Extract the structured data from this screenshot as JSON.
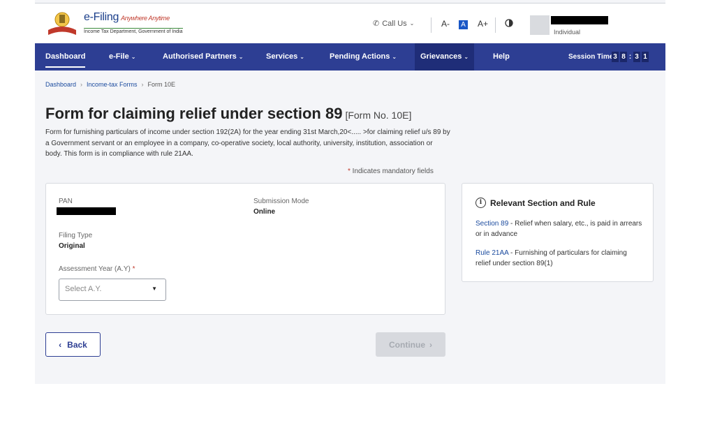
{
  "header": {
    "logo_title": "e-Filing",
    "logo_tagline": "Anywhere Anytime",
    "logo_subtitle": "Income Tax Department, Government of India",
    "call_us": "Call Us",
    "font_decrease": "A-",
    "font_normal": "A",
    "font_increase": "A+",
    "user_type": "Individual"
  },
  "nav": {
    "items": [
      {
        "label": "Dashboard"
      },
      {
        "label": "e-File"
      },
      {
        "label": "Authorised Partners"
      },
      {
        "label": "Services"
      },
      {
        "label": "Pending Actions"
      },
      {
        "label": "Grievances"
      },
      {
        "label": "Help"
      }
    ],
    "session_label": "Session Time",
    "session_digits": [
      "3",
      "8",
      "3",
      "1"
    ]
  },
  "breadcrumb": {
    "items": [
      "Dashboard",
      "Income-tax Forms",
      "Form 10E"
    ]
  },
  "page": {
    "title": "Form for claiming relief under section 89",
    "form_no": "[Form No. 10E]",
    "description": "Form for furnishing particulars of income under section 192(2A) for the year ending 31st March,20<..... >for claiming relief u/s 89 by a Government servant or an employee in a company, co-operative society, local authority, university, institution, association or body. This form is in compliance with rule 21AA.",
    "mandatory_note": "Indicates mandatory fields"
  },
  "form": {
    "pan_label": "PAN",
    "submission_mode_label": "Submission Mode",
    "submission_mode_value": "Online",
    "filing_type_label": "Filing Type",
    "filing_type_value": "Original",
    "ay_label": "Assessment Year (A.Y)",
    "ay_placeholder": "Select A.Y."
  },
  "side": {
    "heading": "Relevant Section and Rule",
    "section_link": "Section 89",
    "section_text": " - Relief when salary, etc., is paid in arrears or in advance",
    "rule_link": "Rule 21AA",
    "rule_text": " - Furnishing of particulars for claiming relief under section 89(1)"
  },
  "buttons": {
    "back": "Back",
    "continue": "Continue"
  },
  "colors": {
    "nav_bg": "#2d3e93",
    "link": "#1a4a9e",
    "required": "#c0392b"
  }
}
